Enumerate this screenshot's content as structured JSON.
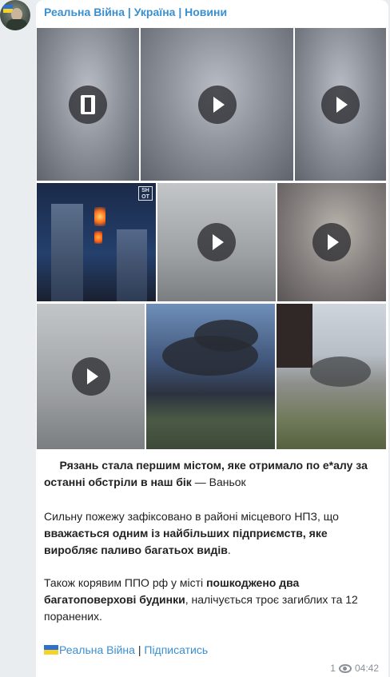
{
  "channel": {
    "name": "Реальна Війна | Україна | Новини"
  },
  "message": {
    "p1_indent": "     ",
    "p1_bold": "Рязань стала першим містом, яке отримало по е*алу за останні обстріли в наш бік",
    "p1_rest": " — Ваньок",
    "p2_start": "Сильну пожежу зафіксовано в районі місцевого НПЗ, що ",
    "p2_bold": "вважається одним із найбільших підприємств, яке виробляє паливо багатьох видів",
    "p2_end": ".",
    "p3_start": "Також корявим ППО рф у місті ",
    "p3_bold": "пошкоджено два багатоповерхові будинки",
    "p3_end": ", налічується троє загиблих та 12 поранених.",
    "footer_link1": "Реальна Війна",
    "footer_sep": " | ",
    "footer_link2": "Підписатись"
  },
  "media_overlay": {
    "shot_badge": "SH OT"
  },
  "meta": {
    "views": "1",
    "time": "04:42"
  },
  "colors": {
    "accent": "#3a8fd0",
    "flag_blue": "#2f6fd0",
    "flag_yellow": "#f5d42a"
  }
}
